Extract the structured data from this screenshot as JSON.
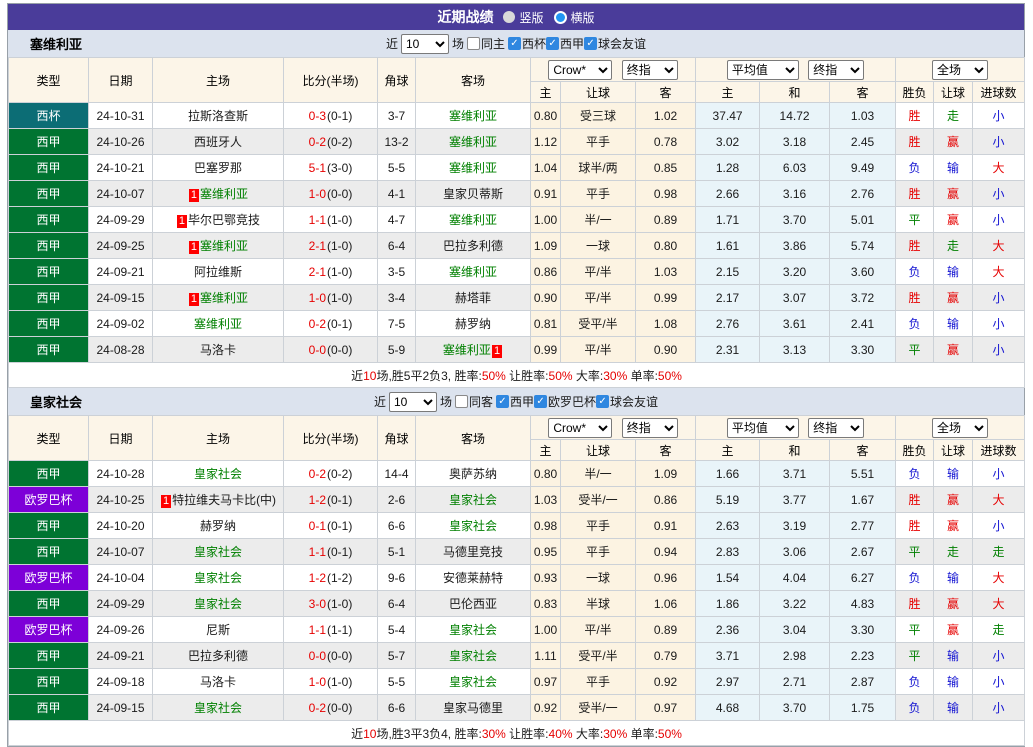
{
  "title_bar": {
    "title": "近期战绩",
    "radios": [
      {
        "label": "竖版",
        "selected": false
      },
      {
        "label": "横版",
        "selected": true
      }
    ]
  },
  "filter_labels": {
    "near": "近",
    "unit": "场"
  },
  "league_colors": {
    "西杯": "#0c6d75",
    "西甲": "#007431",
    "欧罗巴杯": "#7d00d8"
  },
  "table_header": {
    "type": "类型",
    "date": "日期",
    "home": "主场",
    "score": "比分(半场)",
    "corner": "角球",
    "away": "客场",
    "crow_select": "Crow*",
    "final_select": "终指",
    "avg_select": "平均值",
    "avg_final_select": "终指",
    "full_select": "全场",
    "crow_cols": [
      "主",
      "让球",
      "客"
    ],
    "avg_cols": [
      "主",
      "和",
      "客"
    ],
    "result_cols": [
      "胜负",
      "让球",
      "进球数"
    ]
  },
  "sections": [
    {
      "team": "塞维利亚",
      "filter": {
        "count": "10",
        "same_label": "同主",
        "same_checked": false,
        "leagues": [
          {
            "label": "西杯",
            "checked": true
          },
          {
            "label": "西甲",
            "checked": true
          },
          {
            "label": "球会友谊",
            "checked": true
          }
        ]
      },
      "rows": [
        {
          "league": "西杯",
          "date": "24-10-31",
          "home": {
            "name": "拉斯洛查斯"
          },
          "ft": "0-3",
          "ht": "(0-1)",
          "corner": "3-7",
          "away": {
            "name": "塞维利亚",
            "focus": true
          },
          "crow": [
            "0.80",
            "受三球",
            "1.02"
          ],
          "avg": [
            "37.47",
            "14.72",
            "1.03"
          ],
          "res": [
            [
              "胜",
              "r"
            ],
            [
              "走",
              "g"
            ],
            [
              "小",
              "b"
            ]
          ]
        },
        {
          "league": "西甲",
          "date": "24-10-26",
          "home": {
            "name": "西班牙人"
          },
          "ft": "0-2",
          "ht": "(0-2)",
          "corner": "13-2",
          "away": {
            "name": "塞维利亚",
            "focus": true
          },
          "crow": [
            "1.12",
            "平手",
            "0.78"
          ],
          "avg": [
            "3.02",
            "3.18",
            "2.45"
          ],
          "res": [
            [
              "胜",
              "r"
            ],
            [
              "赢",
              "r"
            ],
            [
              "小",
              "b"
            ]
          ]
        },
        {
          "league": "西甲",
          "date": "24-10-21",
          "home": {
            "name": "巴塞罗那"
          },
          "ft": "5-1",
          "ht": "(3-0)",
          "corner": "5-5",
          "away": {
            "name": "塞维利亚",
            "focus": true
          },
          "crow": [
            "1.04",
            "球半/两",
            "0.85"
          ],
          "avg": [
            "1.28",
            "6.03",
            "9.49"
          ],
          "res": [
            [
              "负",
              "b"
            ],
            [
              "输",
              "b"
            ],
            [
              "大",
              "r"
            ]
          ]
        },
        {
          "league": "西甲",
          "date": "24-10-07",
          "home": {
            "name": "塞维利亚",
            "focus": true,
            "badge": "1"
          },
          "ft": "1-0",
          "ht": "(0-0)",
          "corner": "4-1",
          "away": {
            "name": "皇家贝蒂斯"
          },
          "crow": [
            "0.91",
            "平手",
            "0.98"
          ],
          "avg": [
            "2.66",
            "3.16",
            "2.76"
          ],
          "res": [
            [
              "胜",
              "r"
            ],
            [
              "赢",
              "r"
            ],
            [
              "小",
              "b"
            ]
          ]
        },
        {
          "league": "西甲",
          "date": "24-09-29",
          "home": {
            "name": "毕尔巴鄂竞技",
            "badge": "1"
          },
          "ft": "1-1",
          "ht": "(1-0)",
          "corner": "4-7",
          "away": {
            "name": "塞维利亚",
            "focus": true
          },
          "crow": [
            "1.00",
            "半/一",
            "0.89"
          ],
          "avg": [
            "1.71",
            "3.70",
            "5.01"
          ],
          "res": [
            [
              "平",
              "g"
            ],
            [
              "赢",
              "r"
            ],
            [
              "小",
              "b"
            ]
          ]
        },
        {
          "league": "西甲",
          "date": "24-09-25",
          "home": {
            "name": "塞维利亚",
            "focus": true,
            "badge": "1"
          },
          "ft": "2-1",
          "ht": "(1-0)",
          "corner": "6-4",
          "away": {
            "name": "巴拉多利德"
          },
          "crow": [
            "1.09",
            "一球",
            "0.80"
          ],
          "avg": [
            "1.61",
            "3.86",
            "5.74"
          ],
          "res": [
            [
              "胜",
              "r"
            ],
            [
              "走",
              "g"
            ],
            [
              "大",
              "r"
            ]
          ]
        },
        {
          "league": "西甲",
          "date": "24-09-21",
          "home": {
            "name": "阿拉维斯"
          },
          "ft": "2-1",
          "ht": "(1-0)",
          "corner": "3-5",
          "away": {
            "name": "塞维利亚",
            "focus": true
          },
          "crow": [
            "0.86",
            "平/半",
            "1.03"
          ],
          "avg": [
            "2.15",
            "3.20",
            "3.60"
          ],
          "res": [
            [
              "负",
              "b"
            ],
            [
              "输",
              "b"
            ],
            [
              "大",
              "r"
            ]
          ]
        },
        {
          "league": "西甲",
          "date": "24-09-15",
          "home": {
            "name": "塞维利亚",
            "focus": true,
            "badge": "1"
          },
          "ft": "1-0",
          "ht": "(1-0)",
          "corner": "3-4",
          "away": {
            "name": "赫塔菲"
          },
          "crow": [
            "0.90",
            "平/半",
            "0.99"
          ],
          "avg": [
            "2.17",
            "3.07",
            "3.72"
          ],
          "res": [
            [
              "胜",
              "r"
            ],
            [
              "赢",
              "r"
            ],
            [
              "小",
              "b"
            ]
          ]
        },
        {
          "league": "西甲",
          "date": "24-09-02",
          "home": {
            "name": "塞维利亚",
            "focus": true
          },
          "ft": "0-2",
          "ht": "(0-1)",
          "corner": "7-5",
          "away": {
            "name": "赫罗纳"
          },
          "crow": [
            "0.81",
            "受平/半",
            "1.08"
          ],
          "avg": [
            "2.76",
            "3.61",
            "2.41"
          ],
          "res": [
            [
              "负",
              "b"
            ],
            [
              "输",
              "b"
            ],
            [
              "小",
              "b"
            ]
          ]
        },
        {
          "league": "西甲",
          "date": "24-08-28",
          "home": {
            "name": "马洛卡"
          },
          "ft": "0-0",
          "ht": "(0-0)",
          "corner": "5-9",
          "away": {
            "name": "塞维利亚",
            "focus": true,
            "badge": "1",
            "badge_after": true
          },
          "crow": [
            "0.99",
            "平/半",
            "0.90"
          ],
          "avg": [
            "2.31",
            "3.13",
            "3.30"
          ],
          "res": [
            [
              "平",
              "g"
            ],
            [
              "赢",
              "r"
            ],
            [
              "小",
              "b"
            ]
          ]
        }
      ],
      "summary": [
        {
          "text": "近",
          "red": false
        },
        {
          "text": "10",
          "red": true
        },
        {
          "text": "场,胜5平2负3, 胜率:",
          "red": false
        },
        {
          "text": "50%",
          "red": true
        },
        {
          "text": " 让胜率:",
          "red": false
        },
        {
          "text": "50%",
          "red": true
        },
        {
          "text": " 大率:",
          "red": false
        },
        {
          "text": "30%",
          "red": true
        },
        {
          "text": " 单率:",
          "red": false
        },
        {
          "text": "50%",
          "red": true
        }
      ]
    },
    {
      "team": "皇家社会",
      "filter": {
        "count": "10",
        "same_label": "同客",
        "same_checked": false,
        "leagues": [
          {
            "label": "西甲",
            "checked": true
          },
          {
            "label": "欧罗巴杯",
            "checked": true
          },
          {
            "label": "球会友谊",
            "checked": true
          }
        ]
      },
      "rows": [
        {
          "league": "西甲",
          "date": "24-10-28",
          "home": {
            "name": "皇家社会",
            "focus": true
          },
          "ft": "0-2",
          "ht": "(0-2)",
          "corner": "14-4",
          "away": {
            "name": "奥萨苏纳"
          },
          "crow": [
            "0.80",
            "半/一",
            "1.09"
          ],
          "avg": [
            "1.66",
            "3.71",
            "5.51"
          ],
          "res": [
            [
              "负",
              "b"
            ],
            [
              "输",
              "b"
            ],
            [
              "小",
              "b"
            ]
          ]
        },
        {
          "league": "欧罗巴杯",
          "date": "24-10-25",
          "home": {
            "name": "特拉维夫马卡比(中)",
            "badge": "1"
          },
          "ft": "1-2",
          "ht": "(0-1)",
          "corner": "2-6",
          "away": {
            "name": "皇家社会",
            "focus": true
          },
          "crow": [
            "1.03",
            "受半/一",
            "0.86"
          ],
          "avg": [
            "5.19",
            "3.77",
            "1.67"
          ],
          "res": [
            [
              "胜",
              "r"
            ],
            [
              "赢",
              "r"
            ],
            [
              "大",
              "r"
            ]
          ]
        },
        {
          "league": "西甲",
          "date": "24-10-20",
          "home": {
            "name": "赫罗纳"
          },
          "ft": "0-1",
          "ht": "(0-1)",
          "corner": "6-6",
          "away": {
            "name": "皇家社会",
            "focus": true
          },
          "crow": [
            "0.98",
            "平手",
            "0.91"
          ],
          "avg": [
            "2.63",
            "3.19",
            "2.77"
          ],
          "res": [
            [
              "胜",
              "r"
            ],
            [
              "赢",
              "r"
            ],
            [
              "小",
              "b"
            ]
          ]
        },
        {
          "league": "西甲",
          "date": "24-10-07",
          "home": {
            "name": "皇家社会",
            "focus": true
          },
          "ft": "1-1",
          "ht": "(0-1)",
          "corner": "5-1",
          "away": {
            "name": "马德里竞技"
          },
          "crow": [
            "0.95",
            "平手",
            "0.94"
          ],
          "avg": [
            "2.83",
            "3.06",
            "2.67"
          ],
          "res": [
            [
              "平",
              "g"
            ],
            [
              "走",
              "g"
            ],
            [
              "走",
              "g"
            ]
          ]
        },
        {
          "league": "欧罗巴杯",
          "date": "24-10-04",
          "home": {
            "name": "皇家社会",
            "focus": true
          },
          "ft": "1-2",
          "ht": "(1-2)",
          "corner": "9-6",
          "away": {
            "name": "安德莱赫特"
          },
          "crow": [
            "0.93",
            "一球",
            "0.96"
          ],
          "avg": [
            "1.54",
            "4.04",
            "6.27"
          ],
          "res": [
            [
              "负",
              "b"
            ],
            [
              "输",
              "b"
            ],
            [
              "大",
              "r"
            ]
          ]
        },
        {
          "league": "西甲",
          "date": "24-09-29",
          "home": {
            "name": "皇家社会",
            "focus": true
          },
          "ft": "3-0",
          "ht": "(1-0)",
          "corner": "6-4",
          "away": {
            "name": "巴伦西亚"
          },
          "crow": [
            "0.83",
            "半球",
            "1.06"
          ],
          "avg": [
            "1.86",
            "3.22",
            "4.83"
          ],
          "res": [
            [
              "胜",
              "r"
            ],
            [
              "赢",
              "r"
            ],
            [
              "大",
              "r"
            ]
          ]
        },
        {
          "league": "欧罗巴杯",
          "date": "24-09-26",
          "home": {
            "name": "尼斯"
          },
          "ft": "1-1",
          "ht": "(1-1)",
          "corner": "5-4",
          "away": {
            "name": "皇家社会",
            "focus": true
          },
          "crow": [
            "1.00",
            "平/半",
            "0.89"
          ],
          "avg": [
            "2.36",
            "3.04",
            "3.30"
          ],
          "res": [
            [
              "平",
              "g"
            ],
            [
              "赢",
              "r"
            ],
            [
              "走",
              "g"
            ]
          ]
        },
        {
          "league": "西甲",
          "date": "24-09-21",
          "home": {
            "name": "巴拉多利德"
          },
          "ft": "0-0",
          "ht": "(0-0)",
          "corner": "5-7",
          "away": {
            "name": "皇家社会",
            "focus": true
          },
          "crow": [
            "1.11",
            "受平/半",
            "0.79"
          ],
          "avg": [
            "3.71",
            "2.98",
            "2.23"
          ],
          "res": [
            [
              "平",
              "g"
            ],
            [
              "输",
              "b"
            ],
            [
              "小",
              "b"
            ]
          ]
        },
        {
          "league": "西甲",
          "date": "24-09-18",
          "home": {
            "name": "马洛卡"
          },
          "ft": "1-0",
          "ht": "(1-0)",
          "corner": "5-5",
          "away": {
            "name": "皇家社会",
            "focus": true
          },
          "crow": [
            "0.97",
            "平手",
            "0.92"
          ],
          "avg": [
            "2.97",
            "2.71",
            "2.87"
          ],
          "res": [
            [
              "负",
              "b"
            ],
            [
              "输",
              "b"
            ],
            [
              "小",
              "b"
            ]
          ]
        },
        {
          "league": "西甲",
          "date": "24-09-15",
          "home": {
            "name": "皇家社会",
            "focus": true
          },
          "ft": "0-2",
          "ht": "(0-0)",
          "corner": "6-6",
          "away": {
            "name": "皇家马德里"
          },
          "crow": [
            "0.92",
            "受半/一",
            "0.97"
          ],
          "avg": [
            "4.68",
            "3.70",
            "1.75"
          ],
          "res": [
            [
              "负",
              "b"
            ],
            [
              "输",
              "b"
            ],
            [
              "小",
              "b"
            ]
          ]
        }
      ],
      "summary": [
        {
          "text": "近",
          "red": false
        },
        {
          "text": "10",
          "red": true
        },
        {
          "text": "场,胜3平3负4, 胜率:",
          "red": false
        },
        {
          "text": "30%",
          "red": true
        },
        {
          "text": " 让胜率:",
          "red": false
        },
        {
          "text": "40%",
          "red": true
        },
        {
          "text": " 大率:",
          "red": false
        },
        {
          "text": "30%",
          "red": true
        },
        {
          "text": " 单率:",
          "red": false
        },
        {
          "text": "50%",
          "red": true
        }
      ]
    }
  ]
}
